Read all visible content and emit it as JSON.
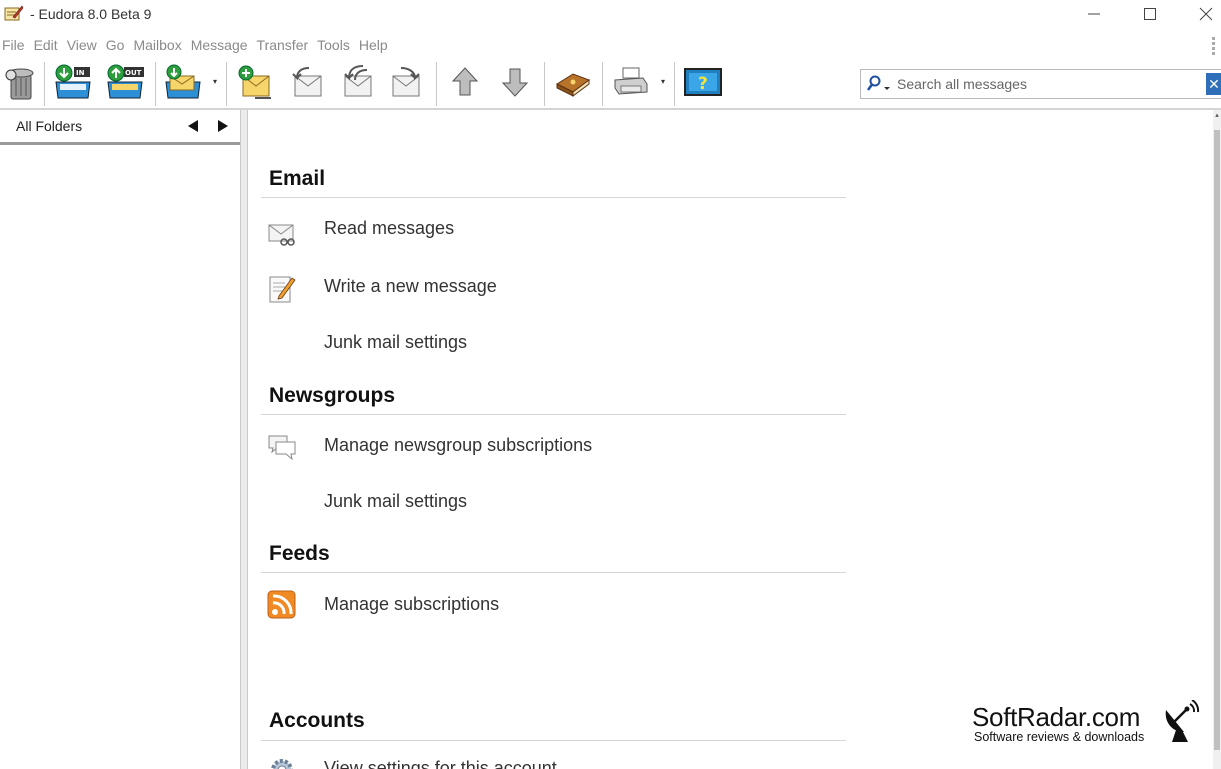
{
  "window": {
    "title": "- Eudora 8.0 Beta 9",
    "minimize_glyph": "—",
    "maximize_glyph": "☐",
    "close_glyph": "✕"
  },
  "menu": [
    "File",
    "Edit",
    "View",
    "Go",
    "Mailbox",
    "Message",
    "Transfer",
    "Tools",
    "Help"
  ],
  "toolbar": {
    "buttons": [
      "trash-icon",
      "check-mail-in-icon",
      "send-queued-out-icon",
      "check-mail-dropdown-icon",
      "new-message-icon",
      "reply-icon",
      "reply-all-icon",
      "forward-icon",
      "previous-message-icon",
      "next-message-icon",
      "address-book-icon",
      "print-icon",
      "help-icon"
    ]
  },
  "search": {
    "placeholder": "Search all messages",
    "clear_glyph": "✕"
  },
  "folders": {
    "label": "All Folders"
  },
  "sections": {
    "email": {
      "title": "Email",
      "items": [
        {
          "label": "Read messages",
          "icon": "read-messages-icon"
        },
        {
          "label": "Write a new message",
          "icon": "write-message-icon"
        },
        {
          "label": "Junk mail settings",
          "icon": ""
        }
      ]
    },
    "newsgroups": {
      "title": "Newsgroups",
      "items": [
        {
          "label": "Manage newsgroup subscriptions",
          "icon": "newsgroup-icon"
        },
        {
          "label": "Junk mail settings",
          "icon": ""
        }
      ]
    },
    "feeds": {
      "title": "Feeds",
      "items": [
        {
          "label": "Manage subscriptions",
          "icon": "rss-icon"
        }
      ]
    },
    "accounts": {
      "title": "Accounts",
      "items": [
        {
          "label": "View settings for this account",
          "icon": "gear-icon"
        }
      ]
    }
  },
  "watermark": {
    "title": "SoftRadar.com",
    "subtitle": "Software reviews & downloads"
  },
  "colors": {
    "menu_text": "#8a8a8a",
    "rss_orange": "#f08a24",
    "help_blue": "#1f7fbf"
  }
}
